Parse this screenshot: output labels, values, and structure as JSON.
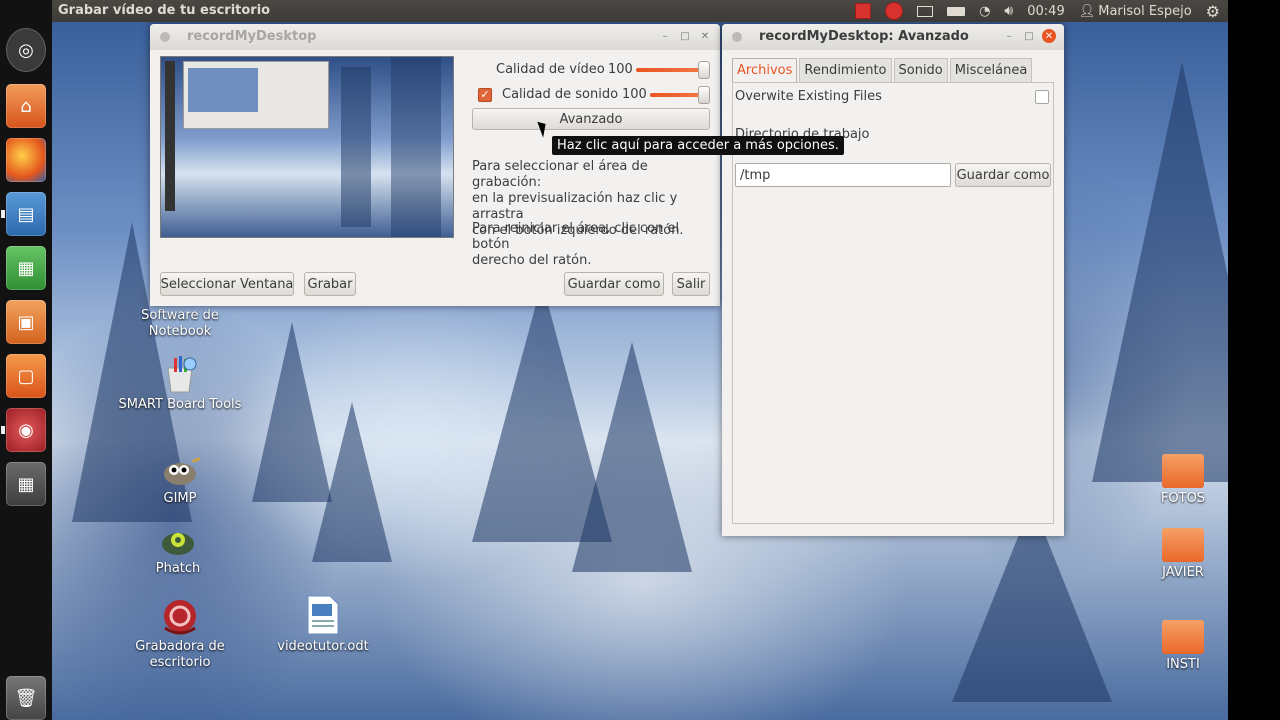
{
  "top_panel": {
    "window_title": "Grabar vídeo de tu escritorio",
    "clock": "00:49",
    "user": "Marisol Espejo",
    "icons": [
      "record-stop-icon",
      "record-dot-icon",
      "mail-icon",
      "battery-icon",
      "wifi-icon",
      "volume-icon",
      "gear-icon"
    ]
  },
  "launcher": {
    "items": [
      "dash-icon",
      "home-folder-icon",
      "firefox-icon",
      "writer-icon",
      "calc-icon",
      "impress-icon",
      "software-center-icon",
      "recorder-icon",
      "workspace-icon",
      "trash-icon"
    ]
  },
  "desktop_icons": {
    "notebook": "Software de\nNotebook",
    "smart": "SMART Board Tools",
    "gimp": "GIMP",
    "phatch": "Phatch",
    "grabadora": "Grabadora de\nescritorio",
    "videotutor": "videotutor.odt",
    "fotos": "FOTOS",
    "javier": "JAVIER",
    "insti": "INSTI"
  },
  "main_window": {
    "title": "recordMyDesktop",
    "video_quality_label": "Calidad de vídeo",
    "video_quality_value": "100",
    "sound_quality_label": "Calidad de sonido",
    "sound_quality_value": "100",
    "sound_enabled": true,
    "video_quality_level": 1.0,
    "sound_quality_level": 1.0,
    "advanced_button": "Avanzado",
    "tooltip": "Haz clic aquí para acceder a más opciones.",
    "help_text_1": "Para seleccionar el área de grabación:\nen la previsualización haz clic y arrastra\ncon el botón izquierdo del ratón.",
    "help_text_2": "Para reiniciar el área, clic con el botón\nderecho del ratón.",
    "select_window_button": "Seleccionar Ventana",
    "record_button": "Grabar",
    "save_as_button": "Guardar como",
    "quit_button": "Salir"
  },
  "advanced_window": {
    "title": "recordMyDesktop: Avanzado",
    "tabs": [
      "Archivos",
      "Rendimiento",
      "Sonido",
      "Miscelánea"
    ],
    "active_tab": "Archivos",
    "overwrite_label": "Overwite Existing Files",
    "overwrite_checked": false,
    "workdir_label": "Directorio de trabajo",
    "workdir_value": "/tmp",
    "save_as_button": "Guardar como"
  },
  "colors": {
    "accent": "#e95420",
    "panel": "#3c3b37"
  }
}
